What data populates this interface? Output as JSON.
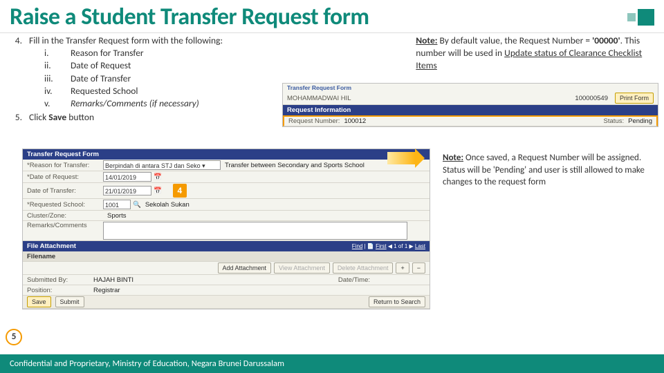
{
  "title": "Raise a Student Transfer Request form",
  "steps": {
    "s4": {
      "num": "4.",
      "lead": "Fill in the Transfer Request form with the following:",
      "items": [
        {
          "n": "i.",
          "t": "Reason for Transfer"
        },
        {
          "n": "ii.",
          "t": "Date of Request"
        },
        {
          "n": "iii.",
          "t": "Date of Transfer"
        },
        {
          "n": "iv.",
          "t": "Requested School"
        },
        {
          "n": "v.",
          "t": "Remarks/Comments (if necessary)"
        }
      ]
    },
    "s5": {
      "num": "5.",
      "pre": "Click ",
      "bold": "Save",
      "post": " button"
    }
  },
  "note1": {
    "label": "Note:",
    "t1": " By default value, the Request Number = ",
    "quote": "'00000'",
    "t2": ". This number will be used in ",
    "link": "Update status of Clearance Checklist Items"
  },
  "note2": {
    "label": "Note:",
    "body": " Once saved, a Request Number will be assigned. Status will be 'Pending' and user is still allowed to make changes to the request form"
  },
  "top_scr": {
    "title": "Transfer Request Form",
    "name": "MOHAMMADWAI HIL",
    "id": "100000549",
    "print": "Print Form",
    "section": "Request Information",
    "reqnum_lab": "Request Number:",
    "reqnum_val": "100012",
    "status_lab": "Status:",
    "status_val": "Pending"
  },
  "form_scr": {
    "title": "Transfer Request Form",
    "reason_lab": "*Reason for Transfer:",
    "reason_sel": "Berpindah di antara STJ dan Seko ▾",
    "reason_desc": "Transfer between Secondary and Sports School",
    "dor_lab": "*Date of Request:",
    "dor_val": "14/01/2019",
    "dot_lab": "Date of Transfer:",
    "dot_val": "21/01/2019",
    "school_lab": "*Requested School:",
    "school_val": "1001",
    "school_name": "Sekolah Sukan",
    "cluster_lab": "Cluster/Zone:",
    "cluster_val": "Sports",
    "remarks_lab": "Remarks/Comments",
    "file_sec": "File Attachment",
    "filename_lab": "Filename",
    "find": "Find",
    "first": "First",
    "last": "Last",
    "range": "1 of 1",
    "add_att": "Add Attachment",
    "view_att": "View Attachment",
    "del_att": "Delete Attachment",
    "sub_lab": "Submitted By:",
    "sub_val": "HAJAH BINTI",
    "pos_lab": "Position:",
    "pos_val": "Registrar",
    "dt_lab": "Date/Time:",
    "save": "Save",
    "submit": "Submit",
    "ret": "Return to Search"
  },
  "callouts": {
    "four": "4",
    "five": "5"
  },
  "footer": "Confidential and Proprietary, Ministry of Education, Negara Brunei Darussalam"
}
